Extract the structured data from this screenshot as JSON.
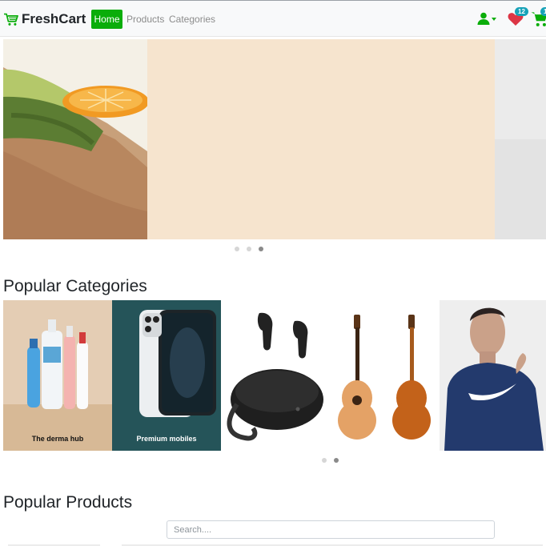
{
  "brand": {
    "name": "FreshCart",
    "accent": "#0aad0a"
  },
  "nav": {
    "items": [
      {
        "label": "Home",
        "active": true
      },
      {
        "label": "Products",
        "active": false
      },
      {
        "label": "Categories",
        "active": false
      }
    ]
  },
  "icons": {
    "logo": "cart-icon",
    "user": "user-icon",
    "wishlist": "heart-icon",
    "cart": "cart-icon"
  },
  "wishlist": {
    "count": "12",
    "color": "#dc3545"
  },
  "cart": {
    "count": "1"
  },
  "badge_color": "#17a2b8",
  "hero": {
    "active_slide": 3,
    "slide_count": 3
  },
  "sections": {
    "categories_title": "Popular Categories",
    "products_title": "Popular Products"
  },
  "categories": {
    "items": [
      {
        "label": "The derma hub"
      },
      {
        "label": "Premium mobiles"
      },
      {
        "label": ""
      },
      {
        "label": ""
      },
      {
        "label": ""
      }
    ],
    "active_page": 2,
    "page_count": 2
  },
  "search": {
    "placeholder": "Search....",
    "value": ""
  }
}
